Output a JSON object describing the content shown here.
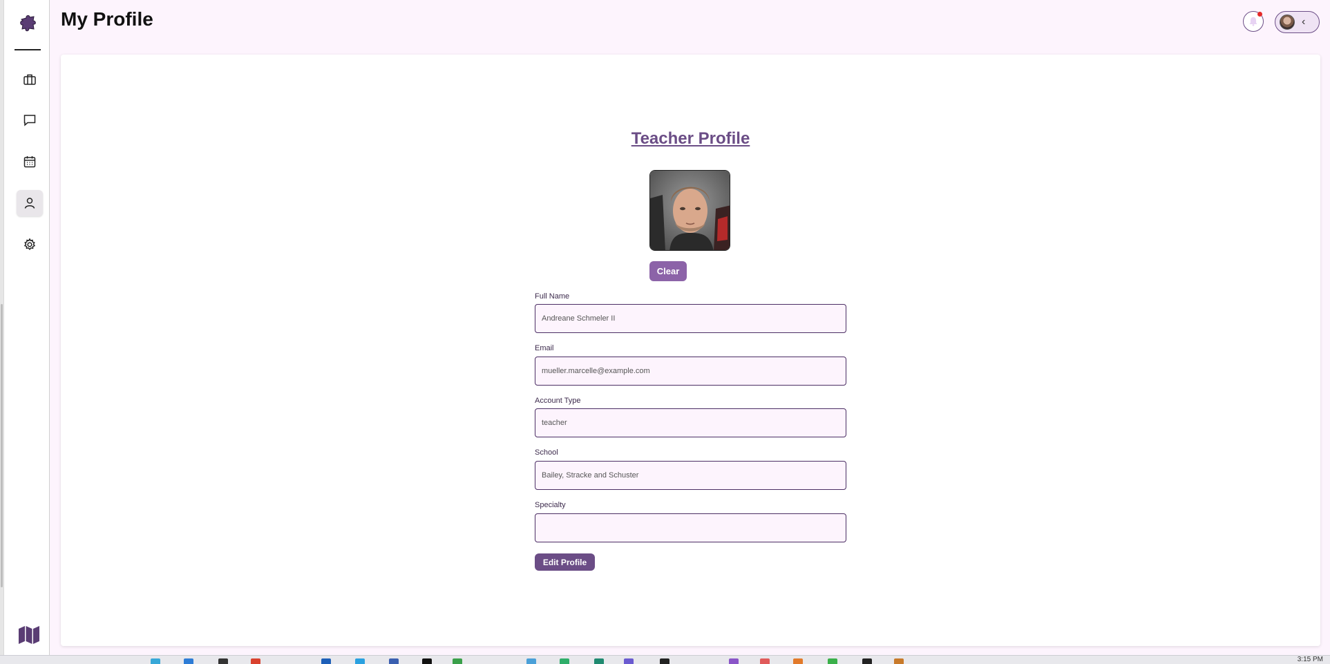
{
  "header": {
    "title": "My Profile"
  },
  "sidebar": {
    "items": [
      {
        "name": "briefcase-icon",
        "label": "Jobs"
      },
      {
        "name": "chat-icon",
        "label": "Messages"
      },
      {
        "name": "calendar-icon",
        "label": "Calendar"
      },
      {
        "name": "user-icon",
        "label": "Profile",
        "active": true
      },
      {
        "name": "gear-icon",
        "label": "Settings"
      }
    ],
    "footer_icon": "map-icon"
  },
  "profile": {
    "heading": "Teacher Profile",
    "clear_label": "Clear",
    "fields": {
      "full_name": {
        "label": "Full Name",
        "value": "Andreane Schmeler II"
      },
      "email": {
        "label": "Email",
        "value": "mueller.marcelle@example.com"
      },
      "account_type": {
        "label": "Account Type",
        "value": "teacher"
      },
      "school": {
        "label": "School",
        "value": "Bailey, Stracke and Schuster"
      },
      "specialty": {
        "label": "Specialty",
        "value": ""
      }
    },
    "edit_label": "Edit Profile"
  },
  "taskbar": {
    "clock": "3:15 PM"
  },
  "colors": {
    "accent": "#6b4d86",
    "accent_light": "#8c63a8",
    "background": "#fdf4fd",
    "notification": "#e52929"
  }
}
